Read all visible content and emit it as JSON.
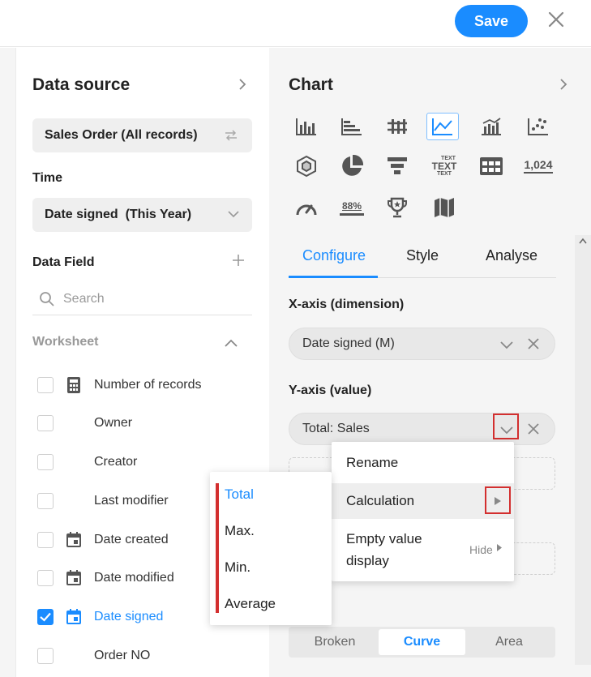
{
  "toolbar": {
    "save_label": "Save"
  },
  "data_source": {
    "title": "Data source",
    "source_select": "Sales Order (All records)",
    "time_label": "Time",
    "time_select": "Date signed  (This Year)",
    "data_field_label": "Data Field",
    "search_placeholder": "Search",
    "worksheet_label": "Worksheet",
    "fields": [
      {
        "label": "Number of records",
        "checked": false,
        "icon": "calculator-icon"
      },
      {
        "label": "Owner",
        "checked": false,
        "icon": ""
      },
      {
        "label": "Creator",
        "checked": false,
        "icon": ""
      },
      {
        "label": "Last modifier",
        "checked": false,
        "icon": ""
      },
      {
        "label": "Date created",
        "checked": false,
        "icon": "calendar-icon"
      },
      {
        "label": "Date modified",
        "checked": false,
        "icon": "calendar-icon"
      },
      {
        "label": "Date signed",
        "checked": true,
        "icon": "calendar-icon"
      },
      {
        "label": "Order NO",
        "checked": false,
        "icon": ""
      }
    ]
  },
  "chart": {
    "title": "Chart",
    "icon_text_text": "TEXT",
    "icon_text_small": "TEXT",
    "icon_percent": "88%",
    "icon_number": "1,024",
    "tabs": [
      "Configure",
      "Style",
      "Analyse"
    ],
    "x_axis_label": "X-axis (dimension)",
    "x_axis_value": "Date signed (M)",
    "y_axis_label": "Y-axis (value)",
    "y_axis_value": "Total: Sales",
    "line_styles": [
      "Broken",
      "Curve",
      "Area"
    ],
    "active_line_style": "Curve"
  },
  "context_menu": {
    "rename": "Rename",
    "calculation": "Calculation",
    "empty_value_line1": "Empty value",
    "empty_value_line2": "display",
    "empty_value_hint": "Hide"
  },
  "calculation_submenu": [
    "Total",
    "Max.",
    "Min.",
    "Average"
  ],
  "colors": {
    "accent": "#1a8cff",
    "highlight_red": "#d32f2f"
  }
}
